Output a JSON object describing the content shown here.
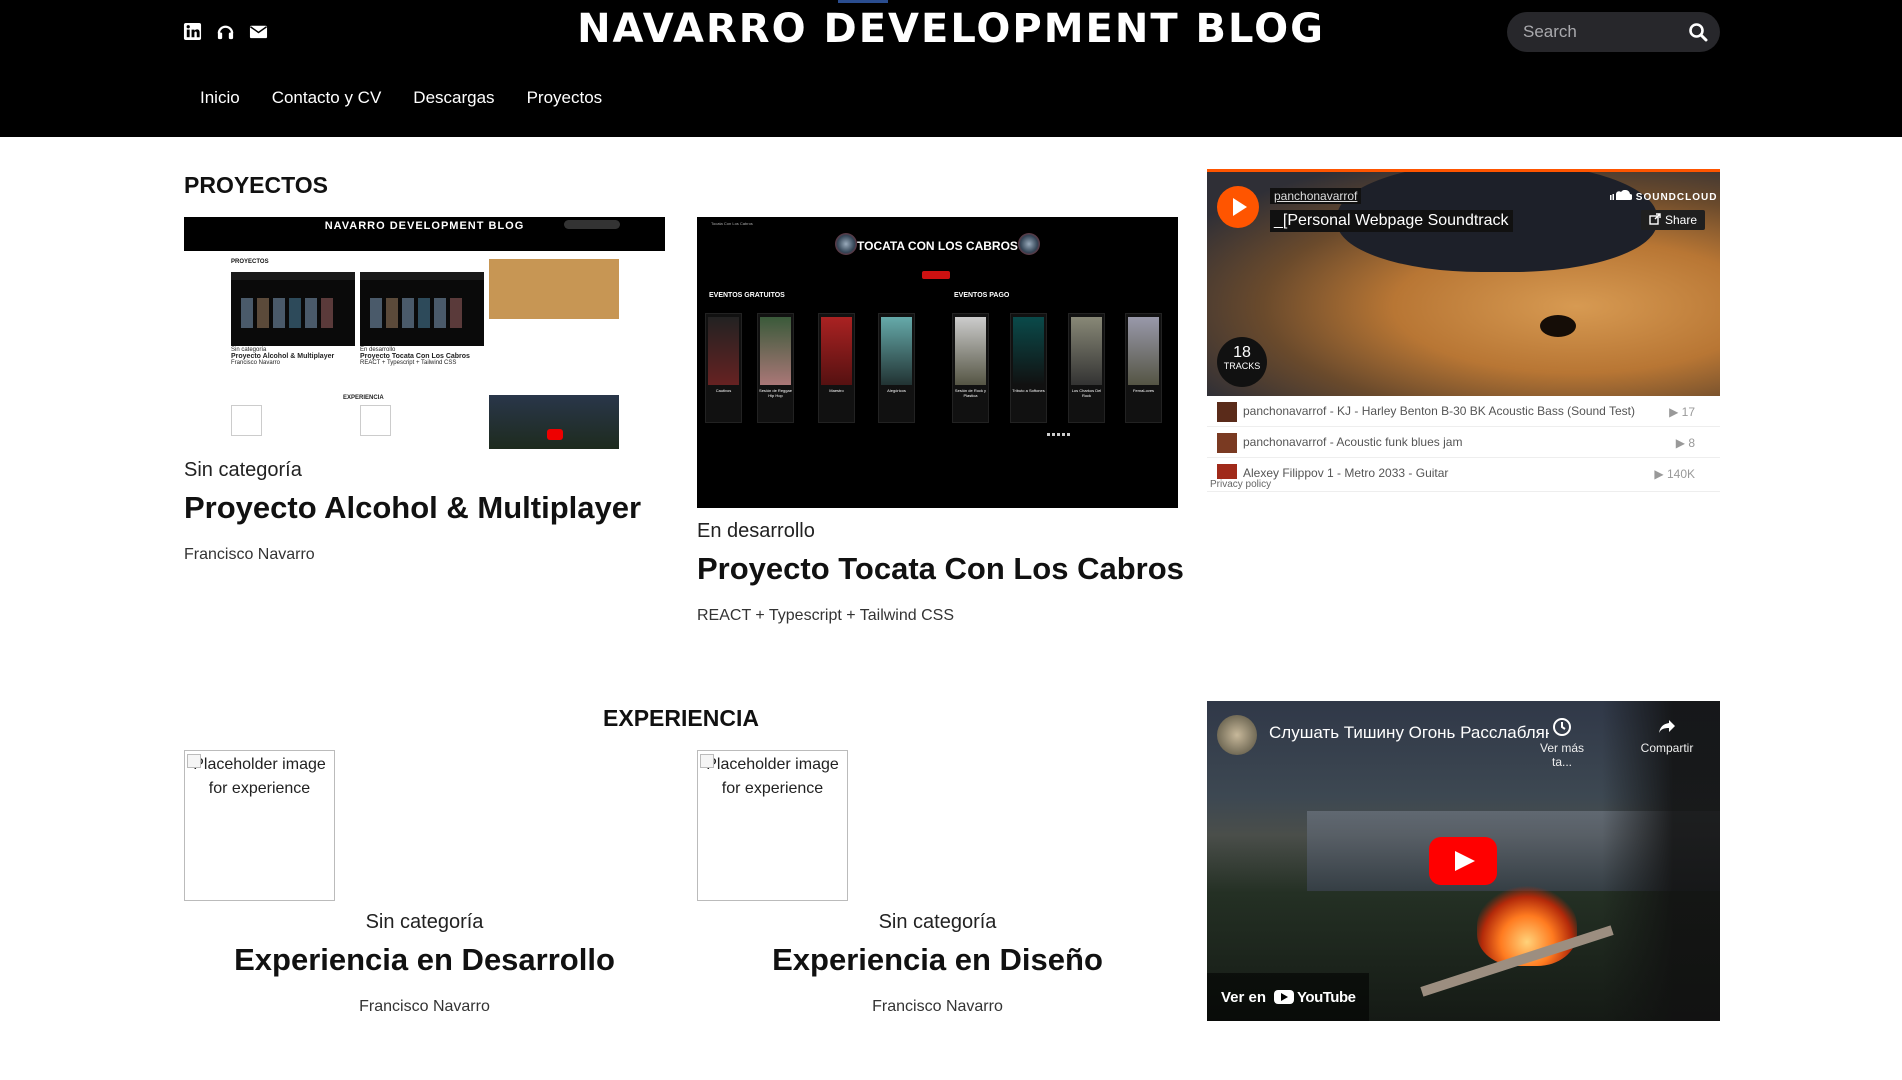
{
  "header": {
    "site_title": "NAVARRO DEVELOPMENT BLOG",
    "social_icons": [
      "linkedin-icon",
      "headphones-icon",
      "envelope-icon"
    ],
    "search_placeholder": "Search",
    "nav": [
      "Inicio",
      "Contacto y CV",
      "Descargas",
      "Proyectos"
    ]
  },
  "proyectos": {
    "heading": "PROYECTOS",
    "items": [
      {
        "category": "Sin categoría",
        "title": "Proyecto Alcohol & Multiplayer",
        "meta": "Francisco Navarro",
        "thumb": {
          "site_title": "NAVARRO DEVELOPMENT BLOG",
          "heading": "PROYECTOS",
          "cap1_cat": "Sin categoría",
          "cap1_title": "Proyecto Alcohol & Multiplayer",
          "cap1_meta": "Francisco Navarro",
          "cap2_cat": "En desarrollo",
          "cap2_title": "Proyecto Tocata Con Los Cabros",
          "cap2_meta": "REACT + Typescript + Tailwind CSS",
          "exp": "EXPERIENCIA"
        }
      },
      {
        "category": "En desarrollo",
        "title": "Proyecto Tocata Con Los Cabros",
        "meta": "REACT + Typescript + Tailwind CSS",
        "thumb": {
          "brand": "Tocata Con Los Cabros",
          "title": "TOCATA CON LOS CABROS",
          "free": "EVENTOS GRATUITOS",
          "paid": "EVENTOS PAGO",
          "posters": [
            "Cautivos",
            "Sesión de Reggae Hip Hop",
            "Maestro",
            "Alegóricos",
            "Sesión de Rock y Plastica",
            "Tributo a Softones",
            "Los Charkos Del Rock",
            "FernaLoves"
          ]
        }
      }
    ]
  },
  "soundcloud": {
    "user": "panchonavarrof",
    "playlist": "_[Personal Webpage Soundtrack",
    "brand": "SOUNDCLOUD",
    "share": "Share",
    "track_count": "18",
    "tracks_label": "TRACKS",
    "tracks": [
      {
        "title": "panchonavarrof - KJ - Harley Benton B-30 BK Acoustic Bass (Sound Test)",
        "plays": "17"
      },
      {
        "title": "panchonavarrof - Acoustic funk blues jam",
        "plays": "8"
      },
      {
        "title": "Alexey Filippov 1 - Metro 2033 - Guitar",
        "plays": "140K"
      }
    ],
    "privacy": "Privacy policy",
    "accent": "#ff5500"
  },
  "experiencia": {
    "heading": "EXPERIENCIA",
    "items": [
      {
        "alt": "Placeholder image for experience",
        "category": "Sin categoría",
        "title": "Experiencia en Desarrollo",
        "meta": "Francisco Navarro"
      },
      {
        "alt": "Placeholder image for experience",
        "category": "Sin categoría",
        "title": "Experiencia en Diseño",
        "meta": "Francisco Navarro"
      }
    ]
  },
  "youtube": {
    "title": "Слушать Тишину Огонь Расслабляющий Звук Костра",
    "watch_later": "Ver más ta...",
    "share": "Compartir",
    "watch_on": "Ver en",
    "logo": "YouTube",
    "accent": "#ff0000"
  }
}
